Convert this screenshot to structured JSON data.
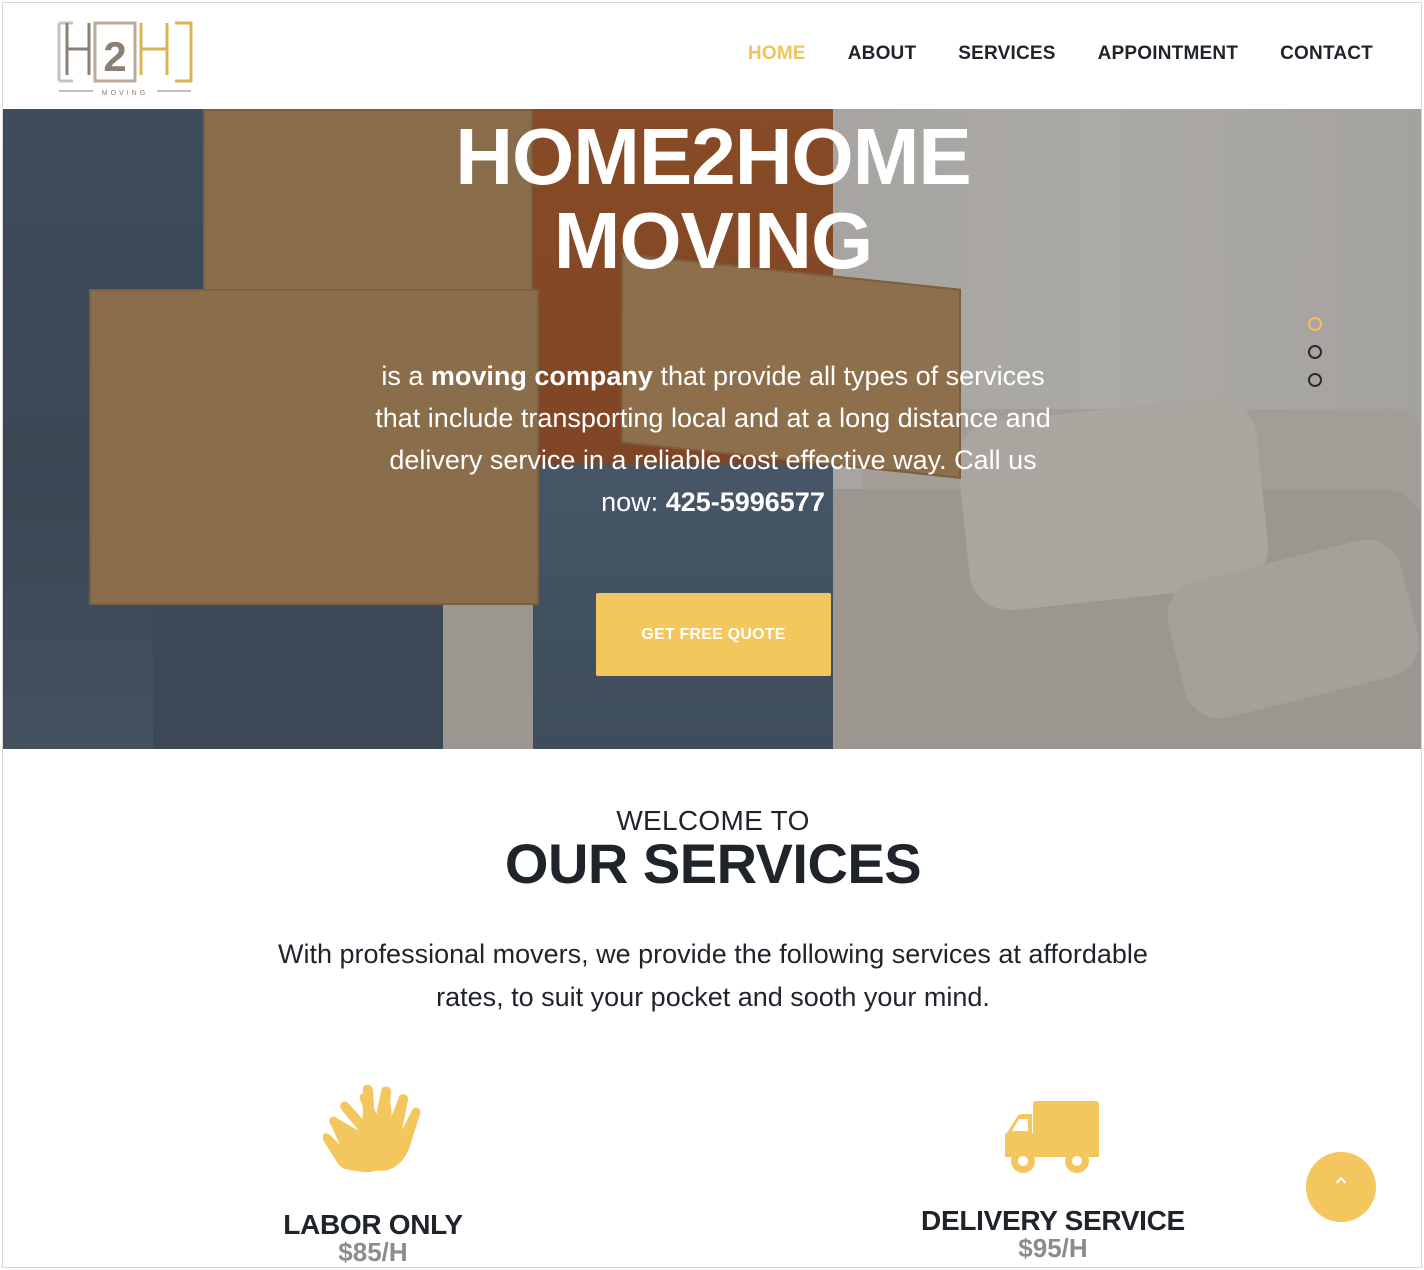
{
  "brand": {
    "logo_text": "H2H",
    "logo_sub": "MOVING"
  },
  "nav": {
    "items": [
      {
        "label": "HOME",
        "active": true
      },
      {
        "label": "ABOUT"
      },
      {
        "label": "SERVICES"
      },
      {
        "label": "APPOINTMENT"
      },
      {
        "label": "CONTACT"
      }
    ]
  },
  "hero": {
    "title_line1": "HOME2HOME",
    "title_line2": "MOVING",
    "desc_part1": "is a ",
    "desc_bold": "moving company",
    "desc_part2": " that provide all types of services that include transporting local and at a long distance and delivery service in a reliable cost effective way. Call us now: ",
    "phone": "425-5996577",
    "cta_label": "GET FREE QUOTE",
    "slides": 3,
    "active_slide": 1
  },
  "services": {
    "welcome": "WELCOME TO",
    "title": "OUR SERVICES",
    "intro": "With professional movers, we provide the following services at affordable rates, to suit your pocket and sooth your mind.",
    "items": [
      {
        "icon": "gloves-icon",
        "title": "LABOR ONLY",
        "price": "$85/H"
      },
      {
        "icon": "truck-icon",
        "title": "DELIVERY SERVICE",
        "price": "$95/H"
      }
    ]
  },
  "colors": {
    "accent": "#f4c65e",
    "text": "#1f242b",
    "price": "#8c8c8c"
  },
  "back_to_top": {
    "icon": "chevron-up-icon",
    "glyph": "⌃"
  }
}
